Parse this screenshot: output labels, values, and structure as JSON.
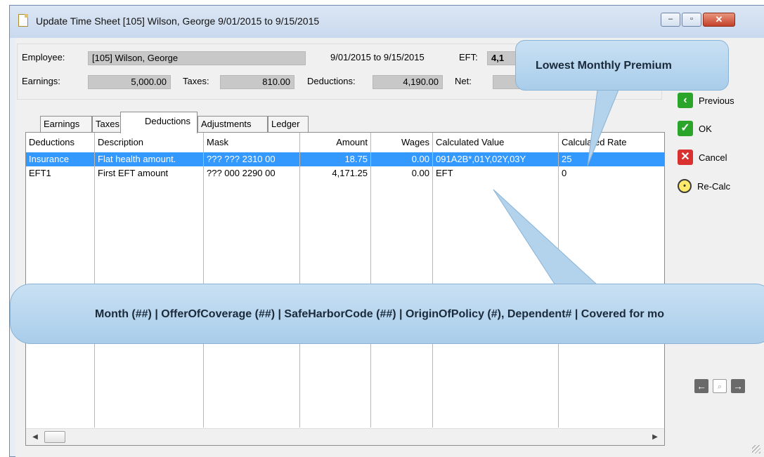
{
  "window": {
    "title": "Update Time Sheet [105] Wilson, George 9/01/2015 to 9/15/2015",
    "minimize_glyph": "‒",
    "maximize_glyph": "▫",
    "close_glyph": "✕"
  },
  "summary": {
    "employee_label": "Employee:",
    "employee_value": "[105] Wilson, George",
    "period_text": "9/01/2015 to 9/15/2015",
    "eft_label": "EFT:",
    "eft_value": "4,1",
    "earnings_label": "Earnings:",
    "earnings_value": "5,000.00",
    "taxes_label": "Taxes:",
    "taxes_value": "810.00",
    "deductions_label": "Deductions:",
    "deductions_value": "4,190.00",
    "net_label": "Net:"
  },
  "tabs": [
    {
      "label": "Earnings"
    },
    {
      "label": "Taxes"
    },
    {
      "label": "Deductions"
    },
    {
      "label": "Adjustments"
    },
    {
      "label": "Ledger"
    }
  ],
  "grid": {
    "columns": [
      "Deductions",
      "Description",
      "Mask",
      "Amount",
      "Wages",
      "Calculated Value",
      "Calculated Rate"
    ],
    "rows": [
      {
        "deduction": "Insurance",
        "description": "Flat health amount.",
        "mask": "??? ??? 2310 00",
        "amount": "18.75",
        "wages": "0.00",
        "calc_value": "091A2B*,01Y,02Y,03Y",
        "calc_rate": "25",
        "selected": true
      },
      {
        "deduction": "EFT1",
        "description": "First EFT amount",
        "mask": "??? 000 2290 00",
        "amount": "4,171.25",
        "wages": "0.00",
        "calc_value": "EFT",
        "calc_rate": "0",
        "selected": false
      }
    ]
  },
  "side_buttons": {
    "previous_label": "Previous",
    "ok_label": "OK",
    "cancel_label": "Cancel",
    "recalc_label": "Re-Calc"
  },
  "icons": {
    "previous": "previous-icon",
    "ok": "check-icon",
    "cancel": "x-icon",
    "recalc": "lightbulb-icon",
    "nav_back": "arrow-left-icon",
    "nav_find": "search-page-icon",
    "nav_forward": "arrow-right-icon"
  },
  "callouts": {
    "top": "Lowest Monthly Premium",
    "bottom": "Month (##) | OfferOfCoverage (##) | SafeHarborCode (##) | OriginOfPolicy (#), Dependent# | Covered for mo"
  },
  "colors": {
    "selection": "#3399ff",
    "callout": "#b9d7ef",
    "ok_green": "#2aa52a",
    "cancel_red": "#d93030"
  }
}
